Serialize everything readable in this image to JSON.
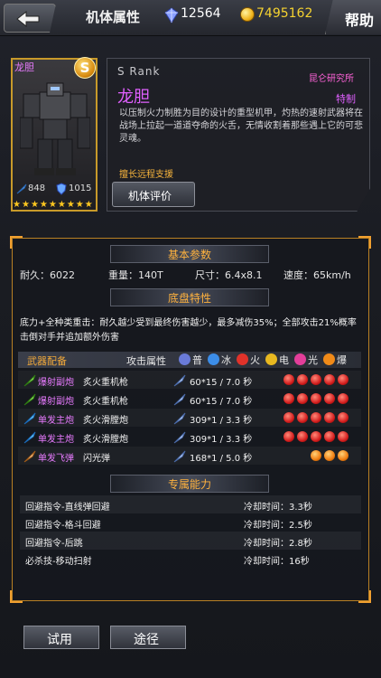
{
  "header": {
    "title": "机体属性",
    "crystals": "12564",
    "coins": "7495162",
    "help_label": "帮助"
  },
  "card": {
    "name": "龙胆",
    "rank_letter": "S",
    "attack": "848",
    "defense": "1015",
    "stars": 9
  },
  "info": {
    "rank": "S  Rank",
    "maker": "昆仑研究所",
    "name": "龙胆",
    "special": "特制",
    "description": "以压制火力制胜为目的设计的重型机甲，灼热的速射武器将在战场上拉起一道道夺命的火舌，无情收割着那些遇上它的可悲灵魂。",
    "specialty": "擅长远程支援",
    "eval_button": "机体评价"
  },
  "basic": {
    "title": "基本参数",
    "durability": "耐久：6022",
    "weight": "重量：140T",
    "size": "尺寸：6.4x8.1",
    "speed": "速度：65km/h"
  },
  "chassis": {
    "title": "底盘特性",
    "text": "底力+全种类重击：耐久越少受到最终伤害越少，最多减伤35%；全部攻击21%概率击倒对手并追加额外伤害"
  },
  "weapons": {
    "header": "武器配备",
    "attr_header": "攻击属性",
    "elements": [
      {
        "label": "普",
        "icon": "normal-element-icon",
        "color": "#6a7bd8"
      },
      {
        "label": "冰",
        "icon": "ice-element-icon",
        "color": "#3c8de8"
      },
      {
        "label": "火",
        "icon": "fire-element-icon",
        "color": "#e0322a"
      },
      {
        "label": "电",
        "icon": "electric-element-icon",
        "color": "#e8b820"
      },
      {
        "label": "光",
        "icon": "light-element-icon",
        "color": "#e33e9a"
      },
      {
        "label": "爆",
        "icon": "blast-element-icon",
        "color": "#f08a18"
      }
    ],
    "rows": [
      {
        "type": "爆射副炮",
        "name": "炙火重机枪",
        "damage": "60*15 / 7.0 秒",
        "icon": "machine-gun-icon",
        "element": "fire",
        "dots": 5
      },
      {
        "type": "爆射副炮",
        "name": "炙火重机枪",
        "damage": "60*15 / 7.0 秒",
        "icon": "machine-gun-icon",
        "element": "fire",
        "dots": 5
      },
      {
        "type": "单发主炮",
        "name": "炙火滑膛炮",
        "damage": "309*1 / 3.3 秒",
        "icon": "cannon-icon",
        "element": "fire",
        "dots": 5
      },
      {
        "type": "单发主炮",
        "name": "炙火滑膛炮",
        "damage": "309*1 / 3.3 秒",
        "icon": "cannon-icon",
        "element": "fire",
        "dots": 5
      },
      {
        "type": "单发飞弹",
        "name": "闪光弹",
        "damage": "168*1 / 5.0 秒",
        "icon": "missile-icon",
        "element": "blast",
        "dots": 3
      }
    ]
  },
  "abilities": {
    "title": "专属能力",
    "rows": [
      {
        "name": "回避指令-直线弹回避",
        "cooldown": "冷却时间：3.3秒"
      },
      {
        "name": "回避指令-格斗回避",
        "cooldown": "冷却时间：2.5秒"
      },
      {
        "name": "回避指令-后跳",
        "cooldown": "冷却时间：2.8秒"
      },
      {
        "name": "必杀技-移动扫射",
        "cooldown": "冷却时间：16秒"
      }
    ]
  },
  "footer": {
    "try_label": "试用",
    "source_label": "途径"
  }
}
